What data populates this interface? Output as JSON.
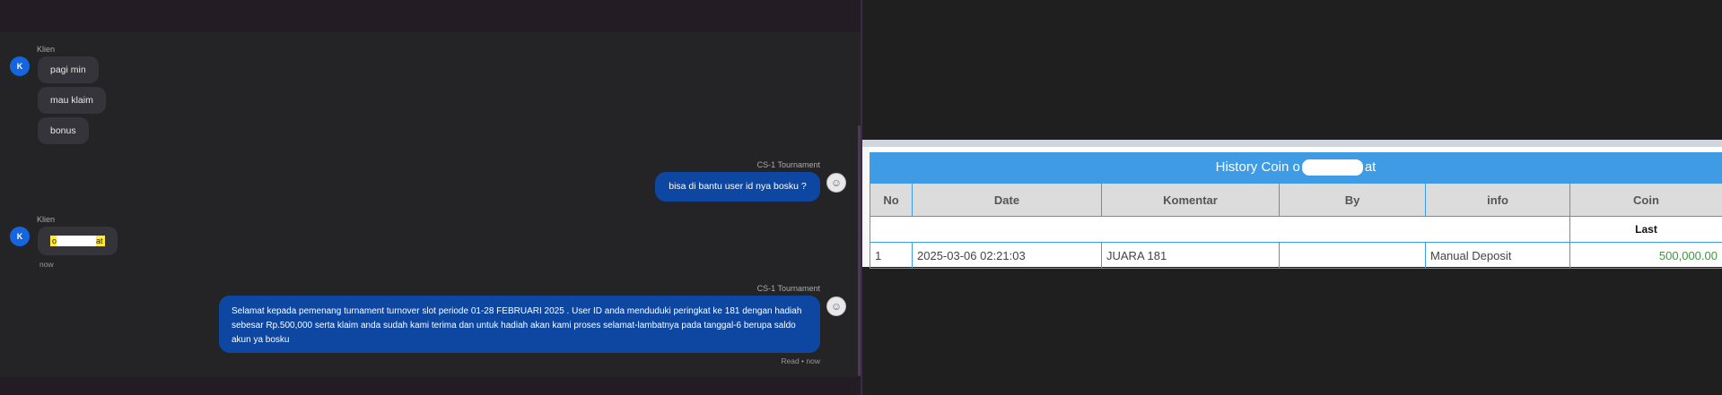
{
  "chat": {
    "messages": [
      {
        "sender": "Klien",
        "avatar": "K",
        "bubbles": [
          "pagi min",
          "mau klaim",
          "bonus"
        ]
      },
      {
        "sender": "CS-1 Tournament",
        "text": "bisa di bantu user id nya bosku ?"
      },
      {
        "sender": "Klien",
        "avatar": "K",
        "text_start": "o",
        "text_end": "at",
        "time": "now"
      },
      {
        "sender": "CS-1 Tournament",
        "text": "Selamat kepada pemenang turnament turnover slot periode 01-28 FEBRUARI 2025 . User ID anda menduduki peringkat ke 181 dengan hadiah sebesar Rp.500,000 serta klaim anda sudah kami terima dan untuk hadiah akan kami proses selamat-lambatnya pada tanggal-6 berupa saldo akun ya bosku",
        "status": "Read • now"
      }
    ]
  },
  "history": {
    "title_start": "History Coin o",
    "title_end": "at",
    "columns": [
      "No",
      "Date",
      "Komentar",
      "By",
      "info",
      "Coin"
    ],
    "last_label": "Last",
    "rows": [
      {
        "no": "1",
        "date": "2025-03-06 02:21:03",
        "komentar": "JUARA 181",
        "by": "",
        "info": "Manual Deposit",
        "coin": "500,000.00"
      }
    ]
  },
  "colors": {
    "accent": "#3f9be3",
    "bubble_out": "#0d47a1",
    "coin": "#3a9a3a"
  }
}
